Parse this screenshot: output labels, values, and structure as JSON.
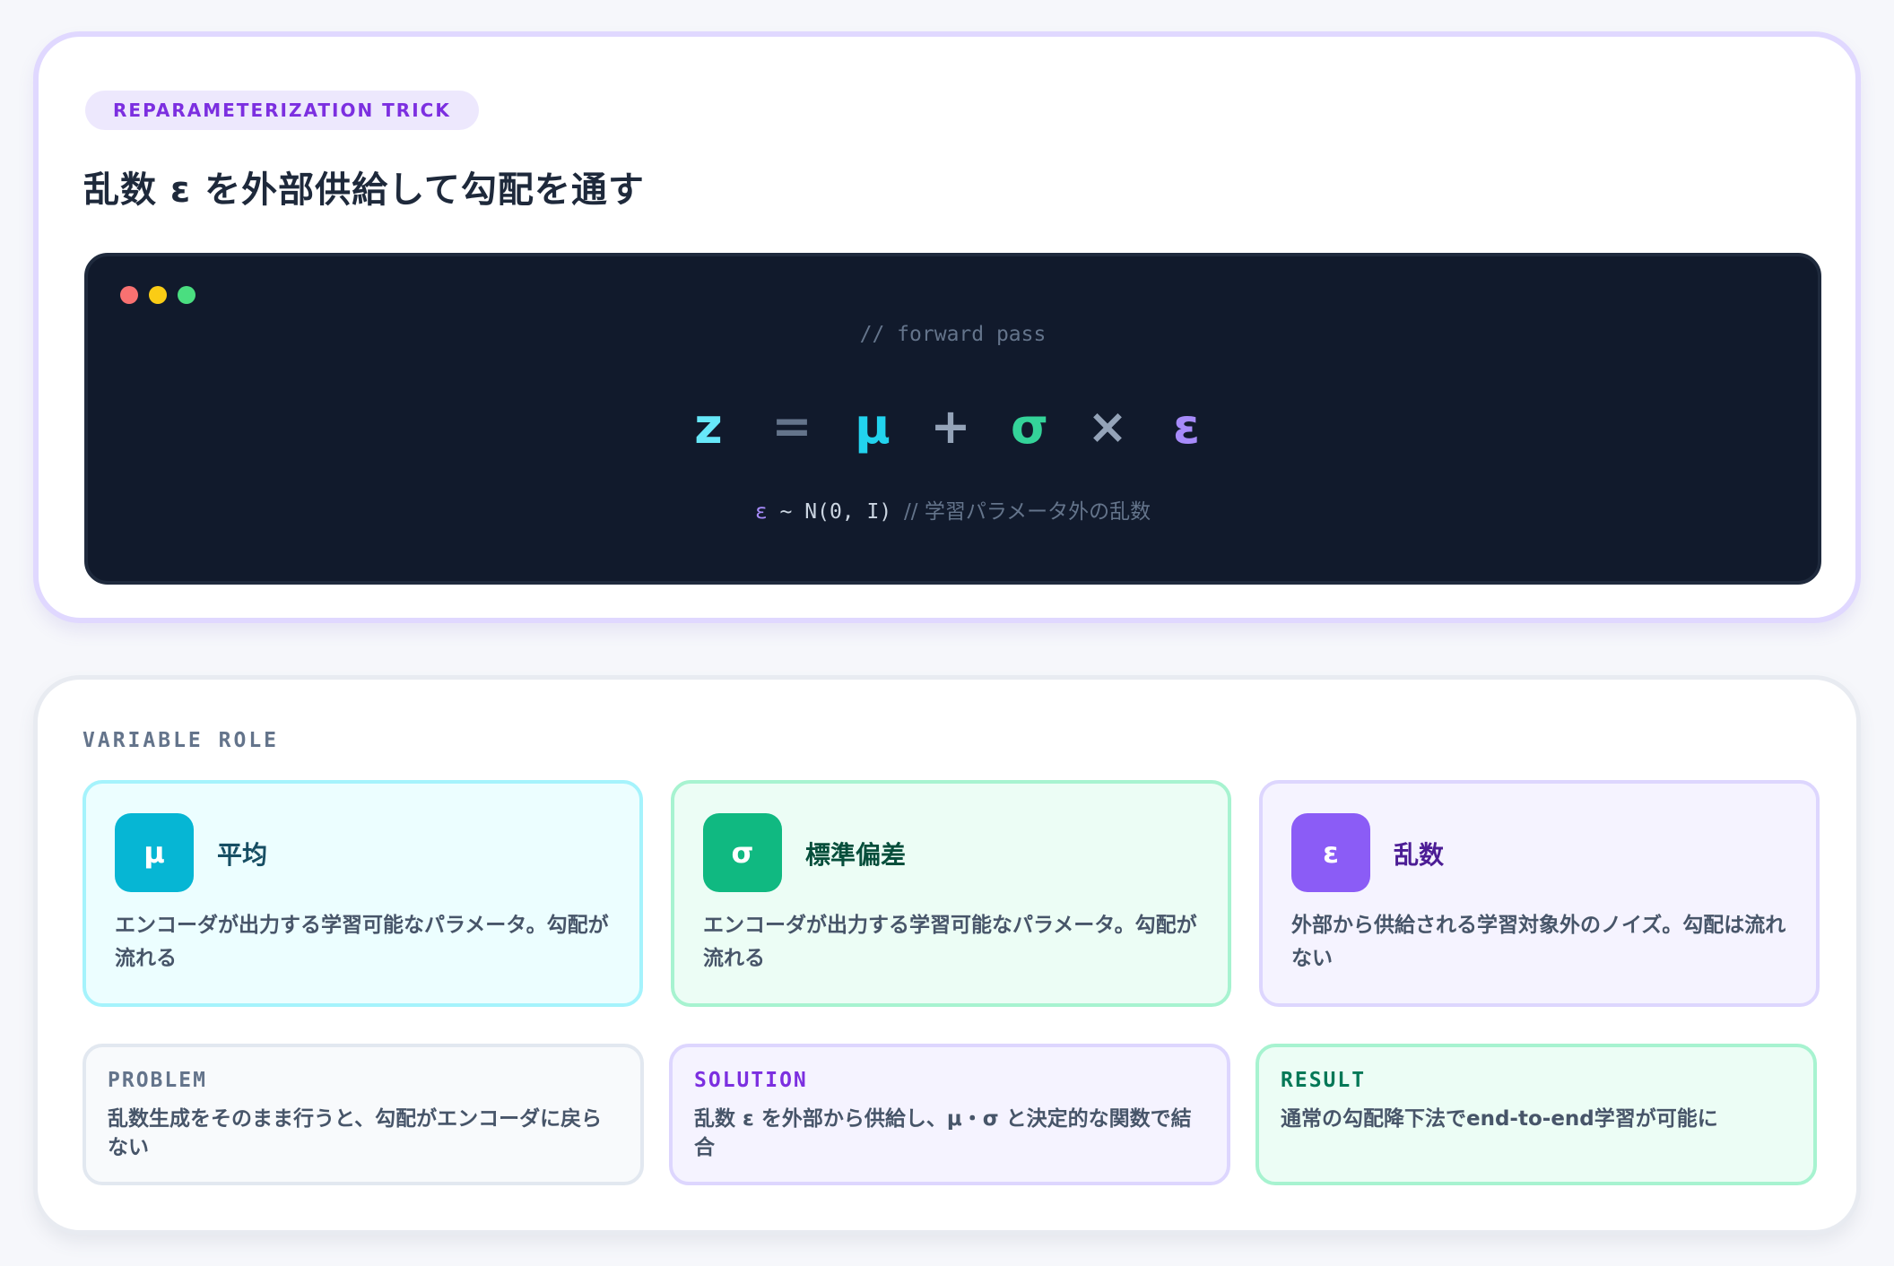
{
  "header": {
    "tag": "REPARAMETERIZATION TRICK",
    "title": "乱数 ε を外部供給して勾配を通す"
  },
  "code": {
    "comment": "// forward pass",
    "formula": {
      "z": "z",
      "eq": "=",
      "mu": "μ",
      "plus": "+",
      "sigma": "σ",
      "times": "×",
      "eps": "ε"
    },
    "dist_eps": "ε",
    "dist_body": " ~ N(0, I) ",
    "dist_comment": "// 学習パラメータ外の乱数"
  },
  "roles": {
    "label": "VARIABLE ROLE",
    "mu": {
      "symbol": "μ",
      "name": "平均",
      "desc": "エンコーダが出力する学習可能なパラメータ。勾配が流れる"
    },
    "sigma": {
      "symbol": "σ",
      "name": "標準偏差",
      "desc": "エンコーダが出力する学習可能なパラメータ。勾配が流れる"
    },
    "eps": {
      "symbol": "ε",
      "name": "乱数",
      "desc": "外部から供給される学習対象外のノイズ。勾配は流れない"
    }
  },
  "notes": {
    "problem": {
      "head": "PROBLEM",
      "body": "乱数生成をそのまま行うと、勾配がエンコーダに戻らない"
    },
    "solution": {
      "head": "SOLUTION",
      "body": "乱数 ε を外部から供給し、μ・σ と決定的な関数で結合"
    },
    "result": {
      "head": "RESULT",
      "body": "通常の勾配降下法でend-to-end学習が可能に"
    }
  },
  "colors": {
    "accent_purple": "#7c2fe0",
    "mu_cyan": "#06b6d4",
    "sigma_green": "#10b981",
    "eps_violet": "#8b5cf6",
    "code_bg": "#111a2c"
  }
}
